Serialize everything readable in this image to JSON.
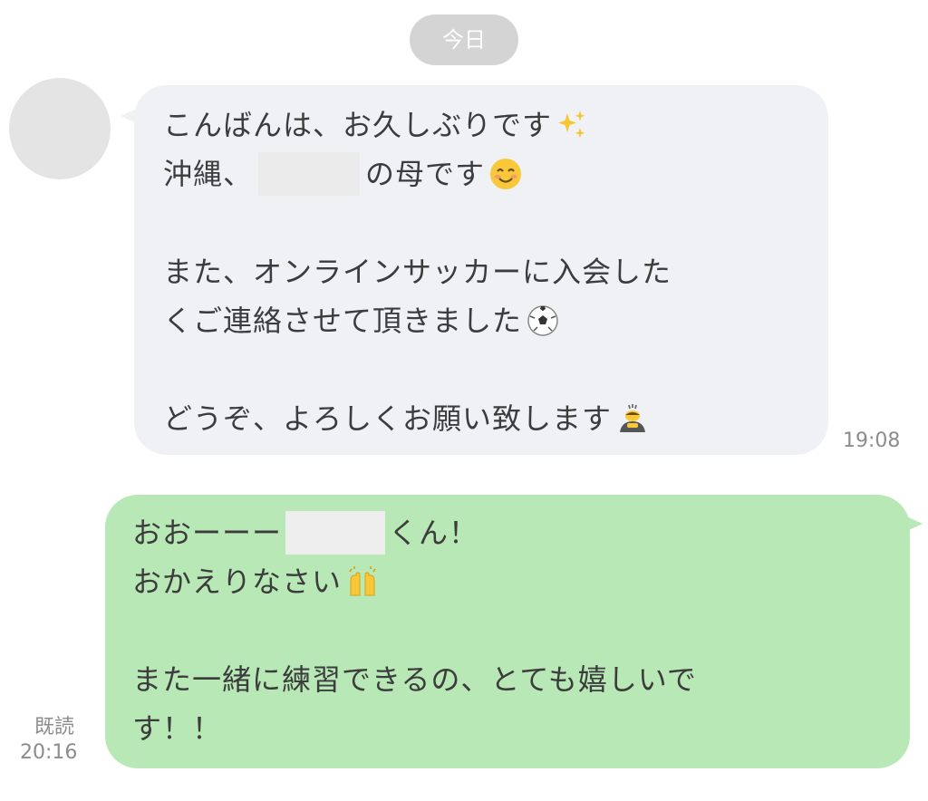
{
  "date_separator": "今日",
  "incoming": {
    "line1": "こんばんは、お久しぶりです",
    "line2_prefix": "沖縄、",
    "line2_suffix": "の母です",
    "line3": "また、オンラインサッカーに入会した",
    "line4": "くご連絡させて頂きました",
    "line5": "どうぞ、よろしくお願い致します",
    "time": "19:08",
    "emojis": [
      "sparkles-icon",
      "smiling-face-icon",
      "soccer-ball-icon",
      "bowing-person-icon"
    ]
  },
  "outgoing": {
    "line1_prefix": "おおーーー",
    "line1_suffix": "くん！",
    "line2": "おかえりなさい",
    "line3": "また一緒に練習できるの、とても嬉しいで",
    "line4": "す！！",
    "read_label": "既読",
    "time": "20:16",
    "emojis": [
      "raising-hands-icon"
    ]
  },
  "colors": {
    "incoming_bubble": "#f0f1f5",
    "outgoing_bubble": "#b7e8b6",
    "date_pill": "#d4d4d4",
    "avatar_placeholder": "#e4e4e4"
  }
}
